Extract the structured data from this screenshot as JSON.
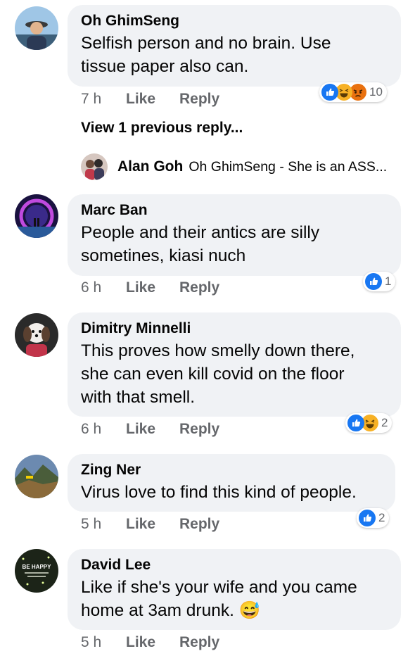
{
  "comments": [
    {
      "author": "Oh GhimSeng",
      "text": "Selfish person and no brain. Use tissue paper also can.",
      "lines": [
        "Selfish person and no brain. Use",
        "tissue paper also can."
      ],
      "time": "7 h",
      "like_label": "Like",
      "reply_label": "Reply",
      "reactions": [
        "like-icon",
        "haha-icon",
        "angry-icon"
      ],
      "reaction_count": "10"
    },
    {
      "author": "Marc Ban",
      "lines": [
        "People and their antics are silly",
        "sometines, kiasi nuch"
      ],
      "time": "6 h",
      "like_label": "Like",
      "reply_label": "Reply",
      "reactions": [
        "like-icon"
      ],
      "reaction_count": "1"
    },
    {
      "author": "Dimitry Minnelli",
      "lines": [
        "This proves how smelly down there,",
        "she can even kill covid on the floor",
        "with that smell."
      ],
      "time": "6 h",
      "like_label": "Like",
      "reply_label": "Reply",
      "reactions": [
        "like-icon",
        "haha-icon"
      ],
      "reaction_count": "2"
    },
    {
      "author": "Zing Ner",
      "lines": [
        "Virus love to find this kind of people."
      ],
      "time": "5 h",
      "like_label": "Like",
      "reply_label": "Reply",
      "reactions": [
        "like-icon"
      ],
      "reaction_count": "2"
    },
    {
      "author": "David Lee",
      "lines": [
        "Like if she's your wife and you came",
        "home at 3am drunk. 😅"
      ],
      "time": "5 h",
      "like_label": "Like",
      "reply_label": "Reply",
      "reactions": [],
      "reaction_count": ""
    }
  ],
  "view_previous": "View 1 previous reply...",
  "reply_preview": {
    "author": "Alan Goh",
    "text": "Oh GhimSeng - She is an ASS..."
  },
  "avatar_badge_david": "BE HAPPY",
  "colors": {
    "bubble": "#f0f2f5",
    "meta": "#65676b",
    "like_blue": "#1877f2",
    "haha_yellow": "#f7b125",
    "angry_orange": "#e9710f"
  }
}
